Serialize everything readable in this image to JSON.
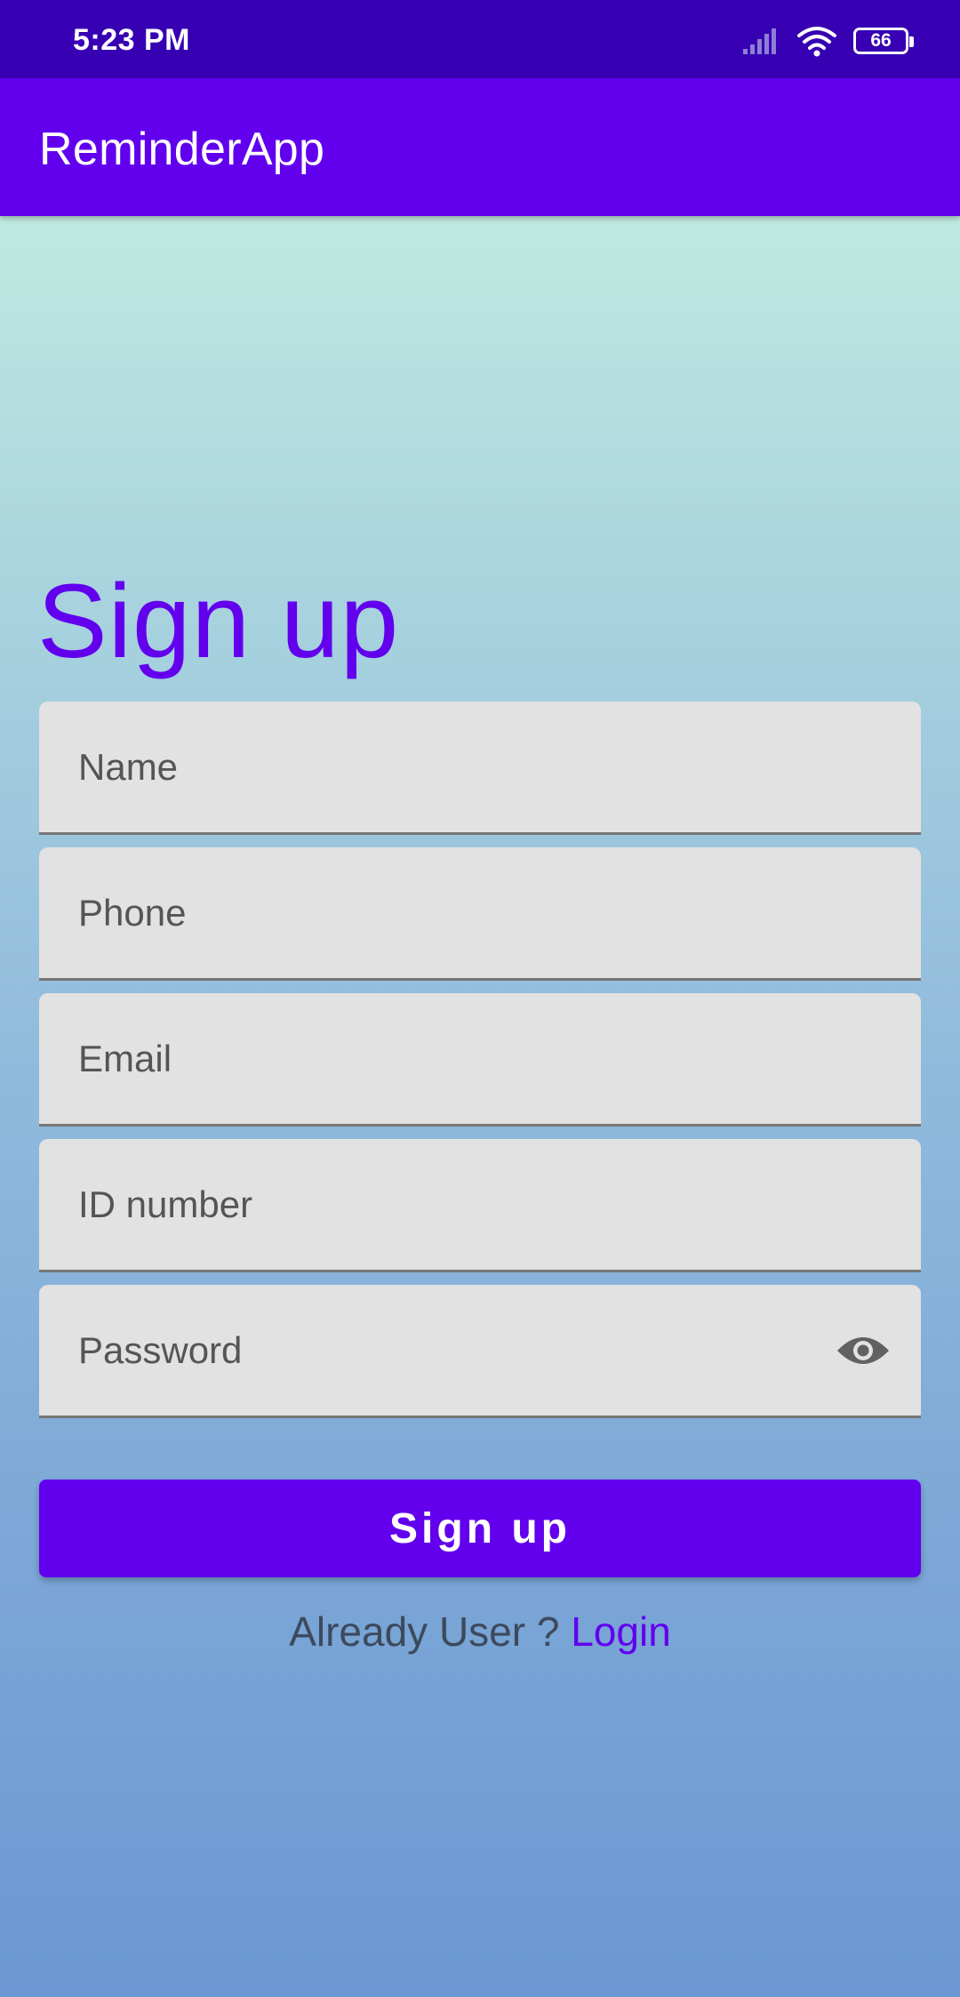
{
  "status_bar": {
    "time": "5:23 PM",
    "battery_level": "66",
    "icons": [
      "signal-icon",
      "wifi-icon",
      "battery-icon"
    ]
  },
  "app_bar": {
    "title": "ReminderApp"
  },
  "form": {
    "heading": "Sign up",
    "fields": [
      {
        "label": "Name",
        "value": ""
      },
      {
        "label": "Phone",
        "value": ""
      },
      {
        "label": "Email",
        "value": ""
      },
      {
        "label": "ID number",
        "value": ""
      },
      {
        "label": "Password",
        "value": "",
        "trailing_icon": "eye-icon"
      }
    ],
    "submit_label": "Sign up",
    "login_prompt": "Already User ?",
    "login_link": "Login"
  },
  "colors": {
    "primary": "#6200ee",
    "primary_dark": "#3700b3",
    "field_background": "#e2e2e2",
    "gradient_top": "#c3ece0",
    "gradient_bottom": "#6b98d2"
  }
}
